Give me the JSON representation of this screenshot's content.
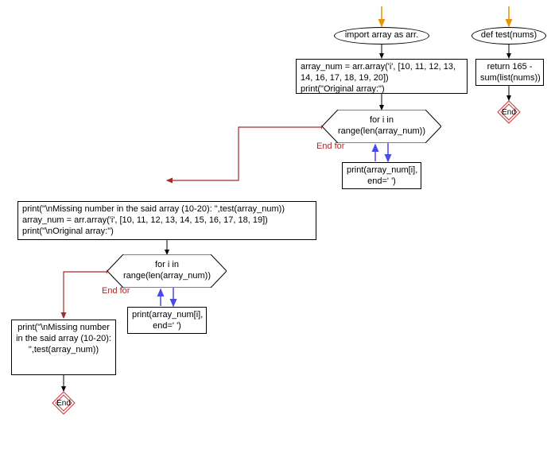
{
  "nodes": {
    "import": "import array as arr.",
    "func_def": "def test(nums)",
    "func_body": "return 165 - sum(list(nums))",
    "init_block": "array_num = arr.array('i', [10, 11, 12, 13, 14, 16, 17, 18, 19, 20])\nprint(\"Original array:\")",
    "loop1": "for i in\nrange(len(array_num))",
    "print1": "print(array_num[i], end=' ')",
    "mid_block": "print(\"\\nMissing number in the said array (10-20): \",test(array_num))\narray_num = arr.array('i', [10, 11, 12, 13, 14, 15, 16, 17, 18, 19])\nprint(\"\\nOriginal array:\")",
    "loop2": "for i in\nrange(len(array_num))",
    "print2": "print(array_num[i], end=' ')",
    "final_block": "print(\"\\nMissing number in the said array (10-20): \",test(array_num))",
    "end": "End"
  },
  "edges": {
    "end_for": "End for",
    "end_for2": "End for"
  },
  "chart_data": {
    "type": "flowchart",
    "description": "Python program flowchart with two branches",
    "branches": [
      {
        "name": "main",
        "start": "import",
        "nodes": [
          {
            "id": "import",
            "shape": "oval",
            "text": "import array as arr."
          },
          {
            "id": "init_block",
            "shape": "rect",
            "text": "array_num = arr.array('i', [10, 11, 12, 13, 14, 16, 17, 18, 19, 20]); print(\"Original array:\")"
          },
          {
            "id": "loop1",
            "shape": "hexagon",
            "text": "for i in range(len(array_num))"
          },
          {
            "id": "print1",
            "shape": "rect",
            "text": "print(array_num[i], end=' ')"
          },
          {
            "id": "mid_block",
            "shape": "rect",
            "text": "print(\"\\nMissing number in the said array (10-20): \",test(array_num)); array_num = arr.array('i', [10, 11, 12, 13, 14, 15, 16, 17, 18, 19]); print(\"\\nOriginal array:\")"
          },
          {
            "id": "loop2",
            "shape": "hexagon",
            "text": "for i in range(len(array_num))"
          },
          {
            "id": "print2",
            "shape": "rect",
            "text": "print(array_num[i], end=' ')"
          },
          {
            "id": "final_block",
            "shape": "rect",
            "text": "print(\"\\nMissing number in the said array (10-20): \",test(array_num))"
          },
          {
            "id": "end_main",
            "shape": "diamond",
            "text": "End"
          }
        ],
        "edges": [
          {
            "from": "start_arrow",
            "to": "import"
          },
          {
            "from": "import",
            "to": "init_block"
          },
          {
            "from": "init_block",
            "to": "loop1"
          },
          {
            "from": "loop1",
            "to": "print1",
            "label": "body",
            "color": "blue"
          },
          {
            "from": "print1",
            "to": "loop1",
            "label": "back",
            "color": "blue"
          },
          {
            "from": "loop1",
            "to": "mid_block",
            "label": "End for",
            "color": "brown"
          },
          {
            "from": "mid_block",
            "to": "loop2"
          },
          {
            "from": "loop2",
            "to": "print2",
            "label": "body",
            "color": "blue"
          },
          {
            "from": "print2",
            "to": "loop2",
            "label": "back",
            "color": "blue"
          },
          {
            "from": "loop2",
            "to": "final_block",
            "label": "End for",
            "color": "brown"
          },
          {
            "from": "final_block",
            "to": "end_main"
          }
        ]
      },
      {
        "name": "function_def",
        "start": "func_def",
        "nodes": [
          {
            "id": "func_def",
            "shape": "oval",
            "text": "def test(nums)"
          },
          {
            "id": "func_body",
            "shape": "rect",
            "text": "return 165 - sum(list(nums))"
          },
          {
            "id": "end_func",
            "shape": "diamond",
            "text": "End"
          }
        ],
        "edges": [
          {
            "from": "start_arrow",
            "to": "func_def"
          },
          {
            "from": "func_def",
            "to": "func_body"
          },
          {
            "from": "func_body",
            "to": "end_func"
          }
        ]
      }
    ]
  }
}
